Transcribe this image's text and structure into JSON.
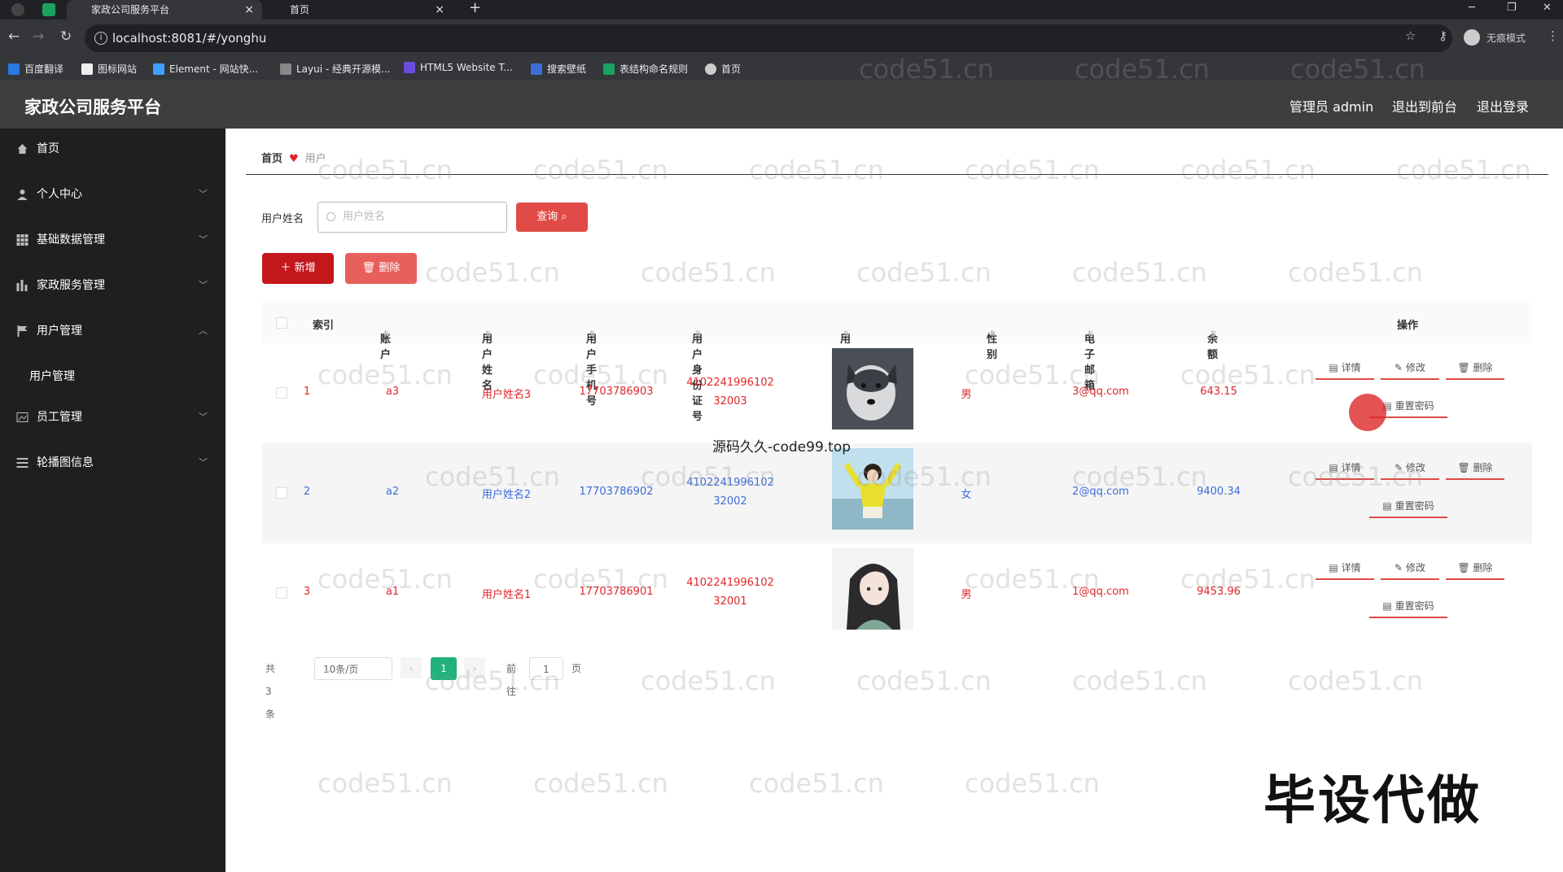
{
  "browser": {
    "tabs": [
      {
        "label": "家政公司服务平台"
      },
      {
        "label": "首页"
      }
    ],
    "url": "localhost:8081/#/yonghu",
    "profile": "无痕模式",
    "bookmarks": [
      "百度翻译",
      "图标网站",
      "Element - 网站快...",
      "Layui - 经典开源模...",
      "HTML5 Website T...",
      "搜索壁纸",
      "表结构命名规则",
      "首页"
    ]
  },
  "app": {
    "title": "家政公司服务平台",
    "header_actions": [
      "管理员 admin",
      "退出到前台",
      "退出登录"
    ]
  },
  "sidebar": {
    "items": [
      {
        "label": "首页",
        "icon": "home-icon"
      },
      {
        "label": "个人中心",
        "icon": "user-icon"
      },
      {
        "label": "基础数据管理",
        "icon": "grid-icon"
      },
      {
        "label": "家政服务管理",
        "icon": "chart-icon"
      },
      {
        "label": "用户管理",
        "icon": "flag-icon"
      },
      {
        "label": "用户管理",
        "icon": ""
      },
      {
        "label": "员工管理",
        "icon": "image-icon"
      },
      {
        "label": "轮播图信息",
        "icon": "list-icon"
      }
    ]
  },
  "breadcrumb": {
    "home": "首页",
    "current": "用户"
  },
  "search": {
    "label": "用户姓名",
    "placeholder": "用户姓名",
    "button": "查询"
  },
  "toolbar": {
    "add": "新增",
    "delete": "删除"
  },
  "table": {
    "headers": [
      "索引",
      "账户",
      "用户姓名",
      "用户手机号",
      "用户身份证号",
      "用户头像",
      "性别",
      "电子邮箱",
      "余额",
      "操作"
    ],
    "rows": [
      {
        "index": "1",
        "account": "a3",
        "name": "用户姓名3",
        "phone": "17703786903",
        "id_line1": "4102241996102",
        "id_line2": "32003",
        "gender": "男",
        "email": "3@qq.com",
        "balance": "643.15"
      },
      {
        "index": "2",
        "account": "a2",
        "name": "用户姓名2",
        "phone": "17703786902",
        "id_line1": "4102241996102",
        "id_line2": "32002",
        "gender": "女",
        "email": "2@qq.com",
        "balance": "9400.34"
      },
      {
        "index": "3",
        "account": "a1",
        "name": "用户姓名1",
        "phone": "17703786901",
        "id_line1": "4102241996102",
        "id_line2": "32001",
        "gender": "男",
        "email": "1@qq.com",
        "balance": "9453.96"
      }
    ],
    "ops": {
      "detail": "详情",
      "edit": "修改",
      "delete": "删除",
      "reset": "重置密码"
    }
  },
  "pager": {
    "total": "共 3 条",
    "size": "10条/页",
    "current": "1",
    "goto": "前往",
    "page_input": "1",
    "page_unit": "页"
  },
  "overlay": {
    "watermark": "code51.cn",
    "source": "源码久久-code99.top",
    "banner": "毕设代做"
  },
  "colors": {
    "primary": "#c3171b",
    "accent": "#e04b47",
    "pager_active": "#20b27a",
    "sidebar": "#1f1f1f",
    "header": "#3e3e3e"
  }
}
